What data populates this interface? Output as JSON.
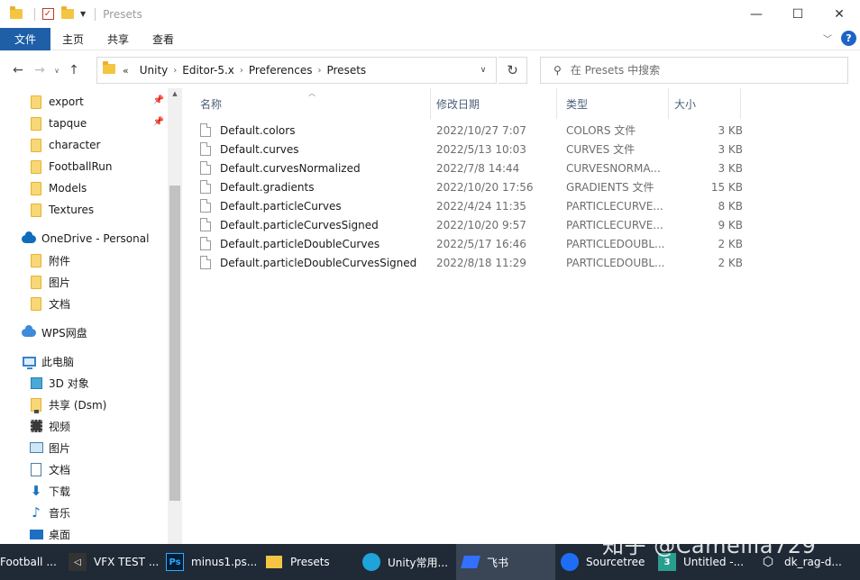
{
  "window": {
    "title": "Presets",
    "controls": {
      "minimize": "—",
      "maximize": "☐",
      "close": "✕"
    }
  },
  "ribbon": {
    "tabs": [
      "文件",
      "主页",
      "共享",
      "查看"
    ],
    "help": "?"
  },
  "address": {
    "overflow": "«",
    "crumbs": [
      "Unity",
      "Editor-5.x",
      "Preferences",
      "Presets"
    ]
  },
  "search": {
    "placeholder": "在 Presets 中搜索"
  },
  "nav": {
    "quick_access": [
      {
        "label": "export",
        "pinned": true
      },
      {
        "label": "tapque",
        "pinned": true
      },
      {
        "label": "character",
        "pinned": false
      },
      {
        "label": "FootballRun",
        "pinned": false
      },
      {
        "label": "Models",
        "pinned": false
      },
      {
        "label": "Textures",
        "pinned": false
      }
    ],
    "onedrive": {
      "label": "OneDrive - Personal",
      "items": [
        "附件",
        "图片",
        "文档"
      ]
    },
    "wps": {
      "label": "WPS网盘"
    },
    "this_pc": {
      "label": "此电脑",
      "items": [
        "3D 对象",
        "共享 (Dsm)",
        "视频",
        "图片",
        "文档",
        "下载",
        "音乐",
        "桌面"
      ]
    }
  },
  "columns": {
    "name": "名称",
    "modified": "修改日期",
    "type": "类型",
    "size": "大小"
  },
  "files": [
    {
      "name": "Default.colors",
      "modified": "2022/10/27 7:07",
      "type": "COLORS 文件",
      "size": "3 KB"
    },
    {
      "name": "Default.curves",
      "modified": "2022/5/13 10:03",
      "type": "CURVES 文件",
      "size": "3 KB"
    },
    {
      "name": "Default.curvesNormalized",
      "modified": "2022/7/8 14:44",
      "type": "CURVESNORMA...",
      "size": "3 KB"
    },
    {
      "name": "Default.gradients",
      "modified": "2022/10/20 17:56",
      "type": "GRADIENTS 文件",
      "size": "15 KB"
    },
    {
      "name": "Default.particleCurves",
      "modified": "2022/4/24 11:35",
      "type": "PARTICLECURVE...",
      "size": "8 KB"
    },
    {
      "name": "Default.particleCurvesSigned",
      "modified": "2022/10/20 9:57",
      "type": "PARTICLECURVE...",
      "size": "9 KB"
    },
    {
      "name": "Default.particleDoubleCurves",
      "modified": "2022/5/17 16:46",
      "type": "PARTICLEDOUBL...",
      "size": "2 KB"
    },
    {
      "name": "Default.particleDoubleCurvesSigned",
      "modified": "2022/8/18 11:29",
      "type": "PARTICLEDOUBL...",
      "size": "2 KB"
    }
  ],
  "taskbar": [
    {
      "label": "Football ...",
      "icon": "app-icon"
    },
    {
      "label": "VFX TEST ...",
      "icon": "visual-studio-icon",
      "glyph": "◁"
    },
    {
      "label": "minus1.ps...",
      "icon": "photoshop-icon",
      "glyph": "Ps"
    },
    {
      "label": "Presets",
      "icon": "folder-icon"
    },
    {
      "label": "Unity常用...",
      "icon": "edge-icon"
    },
    {
      "label": "飞书",
      "icon": "feishu-icon"
    },
    {
      "label": "Sourcetree",
      "icon": "sourcetree-icon"
    },
    {
      "label": "Untitled -...",
      "icon": "3dsmax-icon",
      "glyph": "3"
    },
    {
      "label": "dk_rag-d...",
      "icon": "unity-icon",
      "glyph": "⬡"
    }
  ],
  "watermark": "知乎 @Camellia729",
  "colors": {
    "file_tab": "#1e5fa8",
    "taskbar": "#1f2a36",
    "folder": "#f4c542"
  }
}
